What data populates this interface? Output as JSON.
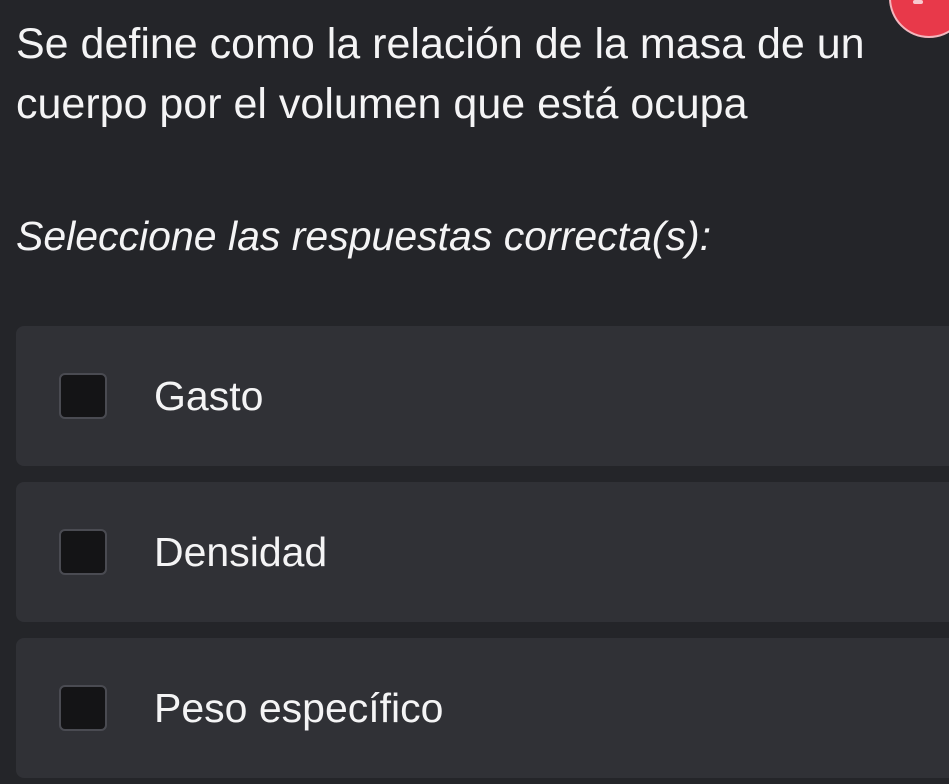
{
  "question": {
    "line1": "Se define como la relación de la masa de un",
    "line2": "cuerpo por el volumen que está ocupa"
  },
  "instruction": "Seleccione las respuestas correcta(s):",
  "options": [
    {
      "label": "Gasto",
      "checked": false
    },
    {
      "label": "Densidad",
      "checked": false
    },
    {
      "label": "Peso específico",
      "checked": false
    }
  ],
  "colors": {
    "background": "#242529",
    "card": "#303136",
    "checkbox": "#141416",
    "badge": "#e8394a"
  }
}
